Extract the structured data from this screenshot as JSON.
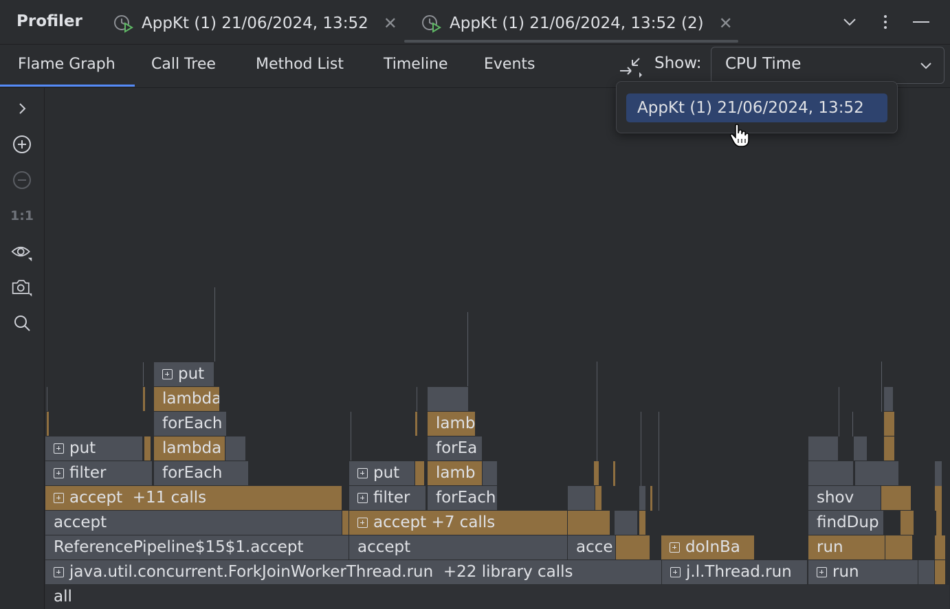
{
  "header": {
    "app_title": "Profiler",
    "tabs": [
      {
        "label": "AppKt (1) 21/06/2024, 13:52",
        "icon": "profiler-snapshot-icon",
        "active": false
      },
      {
        "label": "AppKt (1) 21/06/2024, 13:52 (2)",
        "icon": "profiler-snapshot-icon",
        "active": true
      }
    ]
  },
  "views": {
    "tabs": [
      "Flame Graph",
      "Call Tree",
      "Method List",
      "Timeline",
      "Events"
    ],
    "active": "Flame Graph",
    "show_label": "Show:",
    "show_value": "CPU Time"
  },
  "compare_popup": {
    "items": [
      "AppKt (1) 21/06/2024, 13:52"
    ],
    "selected": "AppKt (1) 21/06/2024, 13:52"
  },
  "toolbar": {
    "items": [
      "expand-icon",
      "zoom-in-icon",
      "zoom-out-icon",
      "actual-size",
      "eye-icon",
      "camera-icon",
      "search-icon"
    ],
    "actual_size_label": "1:1"
  },
  "flame": {
    "root": "all",
    "frames": [
      "java.util.concurrent.ForkJoinWorkerThread.run",
      "+22 library calls",
      "j.l.Thread.run",
      "run",
      "ReferencePipeline$15$1.accept",
      "accept",
      "acce",
      "doInBa",
      "accept",
      "accept",
      "+11 calls",
      "accept",
      "+7 calls",
      "findDup",
      "filter",
      "forEach",
      "put",
      "filter",
      "forEach",
      "shov",
      "put",
      "lambda",
      "lamb",
      "put",
      "lambda",
      "forEa",
      "forEach",
      "lamb",
      "lambda",
      "put"
    ],
    "colors": {
      "library": "#4c5058",
      "user": "#8f6f40",
      "background": "#2b2d30"
    }
  }
}
